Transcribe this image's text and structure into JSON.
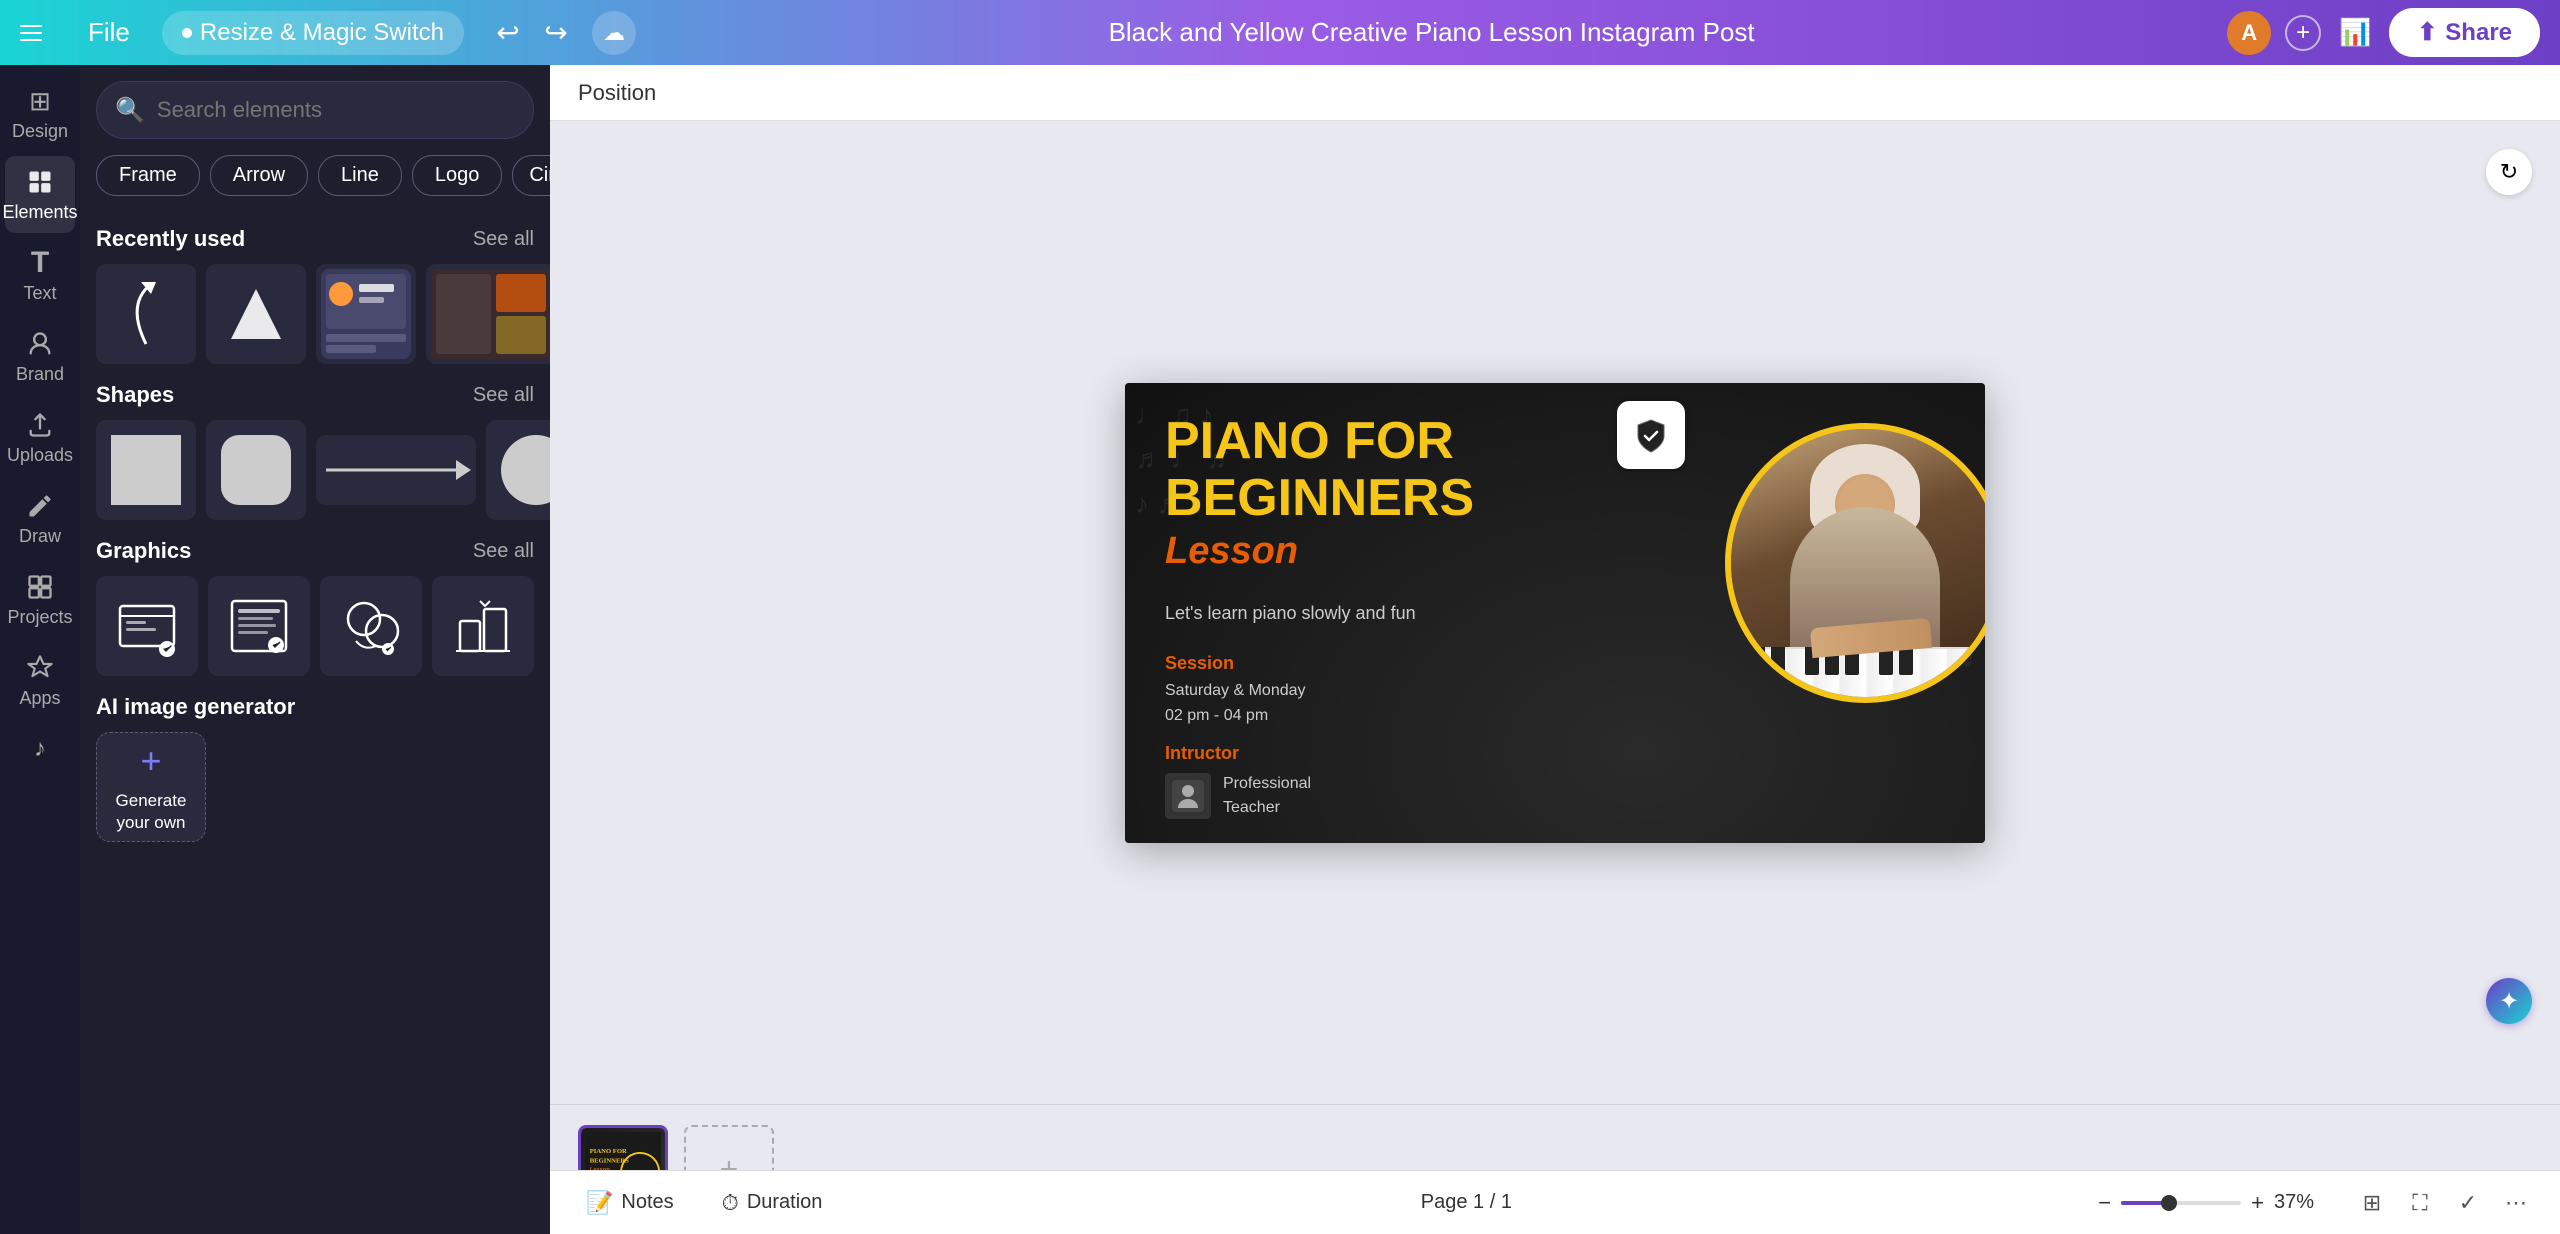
{
  "topbar": {
    "file_label": "File",
    "resize_label": "Resize & Magic Switch",
    "title": "Black and Yellow Creative Piano Lesson Instagram Post",
    "share_label": "Share",
    "avatar_letter": "A"
  },
  "leftnav": {
    "items": [
      {
        "id": "design",
        "label": "Design",
        "icon": "⊞"
      },
      {
        "id": "elements",
        "label": "Elements",
        "icon": "✦",
        "active": true
      },
      {
        "id": "text",
        "label": "Text",
        "icon": "T"
      },
      {
        "id": "brand",
        "label": "Brand",
        "icon": "◈"
      },
      {
        "id": "uploads",
        "label": "Uploads",
        "icon": "⬆"
      },
      {
        "id": "draw",
        "label": "Draw",
        "icon": "✏"
      },
      {
        "id": "projects",
        "label": "Projects",
        "icon": "▦"
      },
      {
        "id": "apps",
        "label": "Apps",
        "icon": "⬡"
      },
      {
        "id": "music",
        "label": "",
        "icon": "♪"
      }
    ]
  },
  "panel": {
    "search_placeholder": "Search elements",
    "quick_tags": [
      "Frame",
      "Arrow",
      "Line",
      "Logo",
      "Circle"
    ],
    "sections": {
      "recently_used": {
        "title": "Recently used",
        "see_all": "See all"
      },
      "shapes": {
        "title": "Shapes",
        "see_all": "See all"
      },
      "graphics": {
        "title": "Graphics",
        "see_all": "See all"
      },
      "ai_generator": {
        "title": "AI image generator",
        "generate_label": "Generate your own"
      }
    }
  },
  "canvas": {
    "position_label": "Position",
    "design": {
      "title_line1": "PIANO FOR",
      "title_line2": "BEGINNERS",
      "subtitle_italic": "Lesson",
      "tagline": "Let's learn piano slowly and fun",
      "session_label": "Session",
      "session_days": "Saturday & Monday",
      "session_time": "02 pm - 04 pm",
      "instructor_label": "Intructor",
      "instructor_role": "Professional",
      "instructor_type": "Teacher"
    }
  },
  "bottombar": {
    "notes_label": "Notes",
    "duration_label": "Duration",
    "page_info": "Page 1 / 1",
    "zoom_level": "37%"
  },
  "colors": {
    "accent": "#6c3fc5",
    "gold": "#f5c518",
    "orange": "#e85d04",
    "topbar_start": "#1ad4d4",
    "topbar_end": "#6c3fc5"
  }
}
